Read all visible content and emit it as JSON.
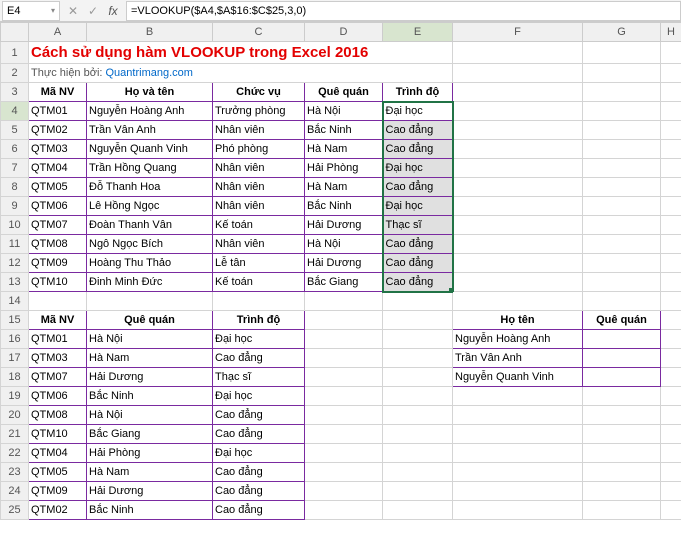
{
  "nameBox": "E4",
  "formula": "=VLOOKUP($A4,$A$16:$C$25,3,0)",
  "columns": [
    "A",
    "B",
    "C",
    "D",
    "E",
    "F",
    "G",
    "H"
  ],
  "title": "Cách sử dụng hàm VLOOKUP trong Excel 2016",
  "subtitlePrefix": "Thực hiện bởi: ",
  "subtitleLink": "Quantrimang.com",
  "table1": {
    "headers": [
      "Mã NV",
      "Họ và tên",
      "Chức vụ",
      "Quê quán",
      "Trình độ"
    ],
    "rows": [
      [
        "QTM01",
        "Nguyễn Hoàng Anh",
        "Trưởng phòng",
        "Hà Nội",
        "Đại học"
      ],
      [
        "QTM02",
        "Trần Vân Anh",
        "Nhân viên",
        "Bắc Ninh",
        "Cao đẳng"
      ],
      [
        "QTM03",
        "Nguyễn Quanh Vinh",
        "Phó phòng",
        "Hà Nam",
        "Cao đẳng"
      ],
      [
        "QTM04",
        "Trần Hồng Quang",
        "Nhân viên",
        "Hải Phòng",
        "Đại học"
      ],
      [
        "QTM05",
        "Đỗ Thanh Hoa",
        "Nhân viên",
        "Hà Nam",
        "Cao đẳng"
      ],
      [
        "QTM06",
        "Lê Hồng Ngọc",
        "Nhân viên",
        "Bắc Ninh",
        "Đại học"
      ],
      [
        "QTM07",
        "Đoàn Thanh Vân",
        "Kế toán",
        "Hải Dương",
        "Thạc sĩ"
      ],
      [
        "QTM08",
        "Ngô Ngọc Bích",
        "Nhân viên",
        "Hà Nội",
        "Cao đẳng"
      ],
      [
        "QTM09",
        "Hoàng Thu Thảo",
        "Lễ tân",
        "Hải Dương",
        "Cao đẳng"
      ],
      [
        "QTM10",
        "Đinh Minh Đức",
        "Kế toán",
        "Bắc Giang",
        "Cao đẳng"
      ]
    ]
  },
  "table2": {
    "headers": [
      "Mã NV",
      "Quê quán",
      "Trình độ"
    ],
    "rows": [
      [
        "QTM01",
        "Hà Nội",
        "Đại học"
      ],
      [
        "QTM03",
        "Hà Nam",
        "Cao đẳng"
      ],
      [
        "QTM07",
        "Hải Dương",
        "Thạc sĩ"
      ],
      [
        "QTM06",
        "Bắc Ninh",
        "Đại học"
      ],
      [
        "QTM08",
        "Hà Nội",
        "Cao đẳng"
      ],
      [
        "QTM10",
        "Bắc Giang",
        "Cao đẳng"
      ],
      [
        "QTM04",
        "Hải Phòng",
        "Đại học"
      ],
      [
        "QTM05",
        "Hà Nam",
        "Cao đẳng"
      ],
      [
        "QTM09",
        "Hải Dương",
        "Cao đẳng"
      ],
      [
        "QTM02",
        "Bắc Ninh",
        "Cao đẳng"
      ]
    ]
  },
  "table3": {
    "headers": [
      "Họ tên",
      "Quê quán"
    ],
    "rows": [
      [
        "Nguyễn Hoàng Anh",
        ""
      ],
      [
        "Trần Vân Anh",
        ""
      ],
      [
        "Nguyễn Quanh Vinh",
        ""
      ]
    ]
  },
  "icons": {
    "dropdown": "▾",
    "cancel": "✕",
    "enter": "✓",
    "fx": "fx",
    "autofill": "⊞"
  }
}
